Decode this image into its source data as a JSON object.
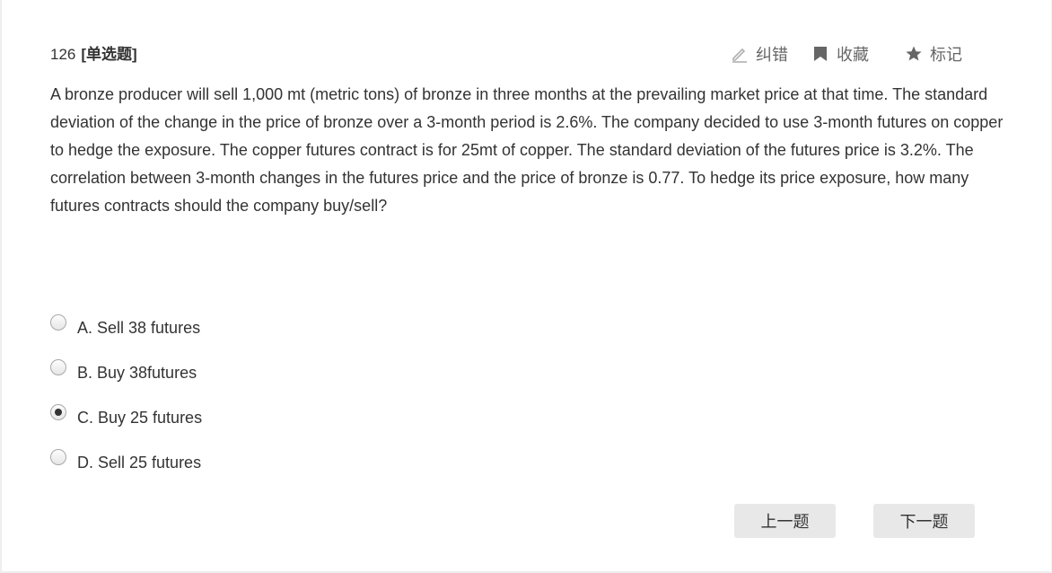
{
  "question": {
    "number": "126",
    "type": "[单选题]",
    "stem": "A bronze producer will sell 1,000 mt (metric tons) of bronze in three months at the prevailing market price at that time. The standard deviation of the change in the price of bronze over a 3-month period is 2.6%. The company decided to use 3-month futures on copper to hedge the exposure. The copper futures contract is for 25mt of copper. The standard deviation of the futures price is 3.2%. The correlation between 3-month changes in the futures price and the price of bronze is 0.77. To hedge its price exposure, how many futures contracts should the company buy/sell?"
  },
  "actions": {
    "correct": {
      "label": "纠错",
      "icon": "pencil-icon"
    },
    "favorite": {
      "label": "收藏",
      "icon": "bookmark-icon"
    },
    "mark": {
      "label": "标记",
      "icon": "star-icon"
    }
  },
  "options": [
    {
      "text": "A. Sell 38 futures",
      "checked": false
    },
    {
      "text": "B. Buy 38futures",
      "checked": false
    },
    {
      "text": "C. Buy 25 futures",
      "checked": true
    },
    {
      "text": "D. Sell 25 futures",
      "checked": false
    }
  ],
  "nav": {
    "prev_label": "上一题",
    "next_label": "下一题"
  },
  "colors": {
    "text": "#333333",
    "icon": "#666666",
    "button_bg": "#e8e8e8"
  }
}
